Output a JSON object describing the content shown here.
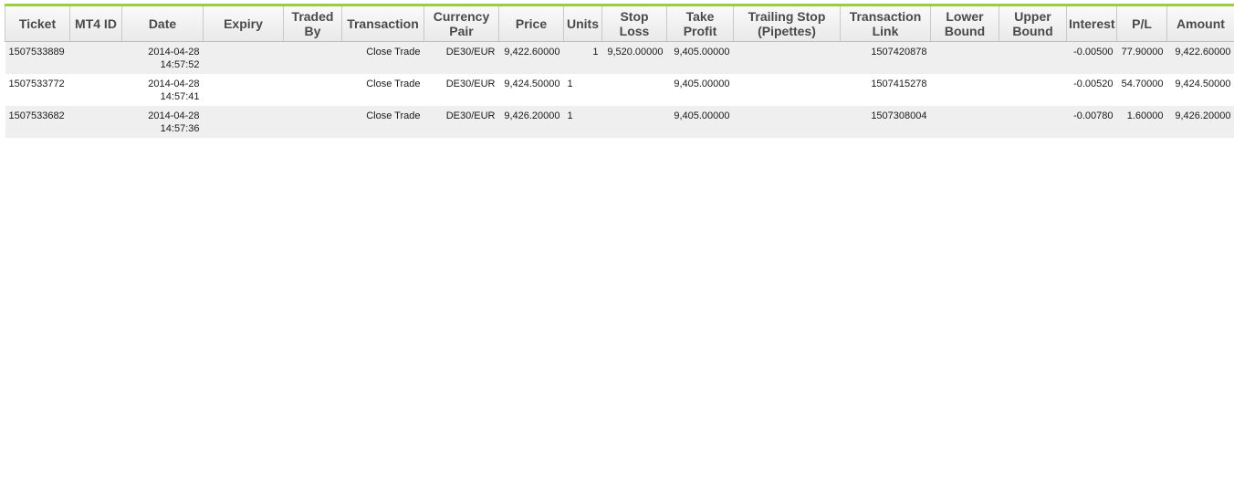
{
  "columns": [
    "Ticket",
    "MT4 ID",
    "Date",
    "Expiry",
    "Traded By",
    "Transaction",
    "Currency Pair",
    "Price",
    "Units",
    "Stop Loss",
    "Take Profit",
    "Trailing Stop (Pipettes)",
    "Transaction Link",
    "Lower Bound",
    "Upper Bound",
    "Interest",
    "P/L",
    "Amount"
  ],
  "rows": [
    {
      "ticket": "1507533889",
      "mt4_id": "",
      "date": "2014-04-28",
      "time": "14:57:52",
      "expiry": "",
      "traded_by": "",
      "transaction": "Close Trade",
      "pair": "DE30/EUR",
      "price": "9,422.60000",
      "units": "1",
      "stop_loss": "9,520.00000",
      "take_profit": "9,405.00000",
      "trailing_stop": "",
      "link": "1507420878",
      "lower": "",
      "upper": "",
      "interest": "-0.00500",
      "pl": "77.90000",
      "amount": "9,422.60000"
    },
    {
      "ticket": "1507533772",
      "mt4_id": "",
      "date": "2014-04-28",
      "time": "14:57:41",
      "expiry": "",
      "traded_by": "",
      "transaction": "Close Trade",
      "pair": "DE30/EUR",
      "price": "9,424.50000",
      "units": "1",
      "stop_loss": "",
      "take_profit": "9,405.00000",
      "trailing_stop": "",
      "link": "1507415278",
      "lower": "",
      "upper": "",
      "interest": "-0.00520",
      "pl": "54.70000",
      "amount": "9,424.50000"
    },
    {
      "ticket": "1507533682",
      "mt4_id": "",
      "date": "2014-04-28",
      "time": "14:57:36",
      "expiry": "",
      "traded_by": "",
      "transaction": "Close Trade",
      "pair": "DE30/EUR",
      "price": "9,426.20000",
      "units": "1",
      "stop_loss": "",
      "take_profit": "9,405.00000",
      "trailing_stop": "",
      "link": "1507308004",
      "lower": "",
      "upper": "",
      "interest": "-0.00780",
      "pl": "1.60000",
      "amount": "9,426.20000"
    }
  ],
  "colors": {
    "accent": "#9acd3c",
    "header_bg": "#eeeeee",
    "row_alt": "#efefef"
  }
}
